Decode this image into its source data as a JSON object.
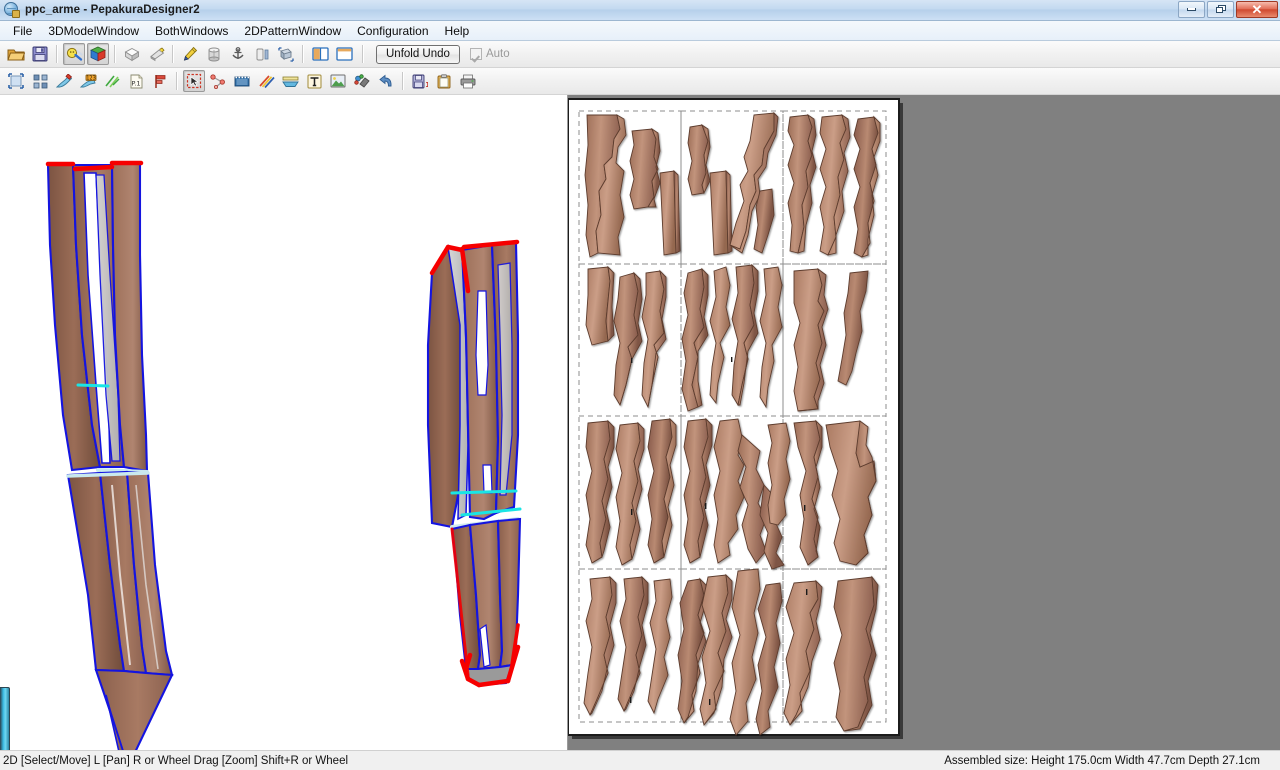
{
  "window": {
    "title": "ppc_arme - PepakuraDesigner2",
    "icon": "app-globe-scissors-icon",
    "buttons": {
      "minimize": "minimize",
      "maximize": "maximize",
      "close": "close"
    }
  },
  "menubar": {
    "items": [
      {
        "label": "File"
      },
      {
        "label": "3DModelWindow"
      },
      {
        "label": "BothWindows"
      },
      {
        "label": "2DPatternWindow"
      },
      {
        "label": "Configuration"
      },
      {
        "label": "Help"
      }
    ]
  },
  "toolbar_primary": {
    "buttons": [
      {
        "icon": "open-folder-icon",
        "pressed": false
      },
      {
        "icon": "save-disk-icon",
        "pressed": false
      },
      {
        "sep": true
      },
      {
        "icon": "unfold-tool-icon",
        "pressed": true
      },
      {
        "icon": "color-cube-icon",
        "pressed": true
      },
      {
        "sep": true
      },
      {
        "icon": "flat-shading-icon",
        "pressed": false
      },
      {
        "icon": "smooth-shading-icon",
        "pressed": false
      },
      {
        "sep": true
      },
      {
        "icon": "pencil-edit-icon",
        "pressed": false
      },
      {
        "icon": "cylinder-icon",
        "pressed": false
      },
      {
        "icon": "anchor-join-icon",
        "pressed": false
      },
      {
        "icon": "split-face-icon",
        "pressed": false
      },
      {
        "icon": "rotate-model-icon",
        "pressed": false
      },
      {
        "sep": true
      },
      {
        "icon": "split-window-icon",
        "pressed": false
      },
      {
        "icon": "single-window-icon",
        "pressed": false
      },
      {
        "sep": true
      }
    ],
    "unfold_undo_label": "Unfold Undo",
    "auto_label": "Auto",
    "auto_checked": true,
    "auto_enabled": false
  },
  "toolbar_secondary": {
    "buttons": [
      {
        "icon": "select-region-icon",
        "pressed": false
      },
      {
        "icon": "arrange-parts-icon",
        "pressed": false
      },
      {
        "icon": "paint-edge-icon",
        "pressed": false
      },
      {
        "icon": "number-labels-icon",
        "pressed": false
      },
      {
        "icon": "flip-edge-icon",
        "pressed": false
      },
      {
        "icon": "page-number-icon",
        "pressed": false
      },
      {
        "icon": "flag-marker-icon",
        "pressed": false
      },
      {
        "sep": true
      },
      {
        "icon": "select-move-cursor-icon",
        "pressed": true
      },
      {
        "icon": "edge-connect-icon",
        "pressed": false
      },
      {
        "icon": "cut-line-icon",
        "pressed": false
      },
      {
        "icon": "fold-line-icon",
        "pressed": false
      },
      {
        "icon": "flap-tab-icon",
        "pressed": false
      },
      {
        "icon": "text-tool-icon",
        "pressed": false
      },
      {
        "icon": "image-tool-icon",
        "pressed": false
      },
      {
        "icon": "texture-paint-icon",
        "pressed": false
      },
      {
        "icon": "undo-arrow-icon",
        "pressed": false
      },
      {
        "sep": true
      },
      {
        "icon": "save-page-icon",
        "pressed": false
      },
      {
        "icon": "clipboard-icon",
        "pressed": false
      },
      {
        "icon": "print-icon",
        "pressed": false
      }
    ]
  },
  "panes": {
    "model_3d": {
      "name": "3D Model Window",
      "background": "#ffffff",
      "edge_colors": {
        "open_edge": "#ff0000",
        "fold_edge": "#0000ff",
        "glued_edge": "#00e5e5"
      },
      "material_color": "#9d6f59"
    },
    "pattern_2d": {
      "name": "2D Pattern Window",
      "background": "#808080",
      "paper_color": "#ffffff",
      "guide_line_color": "#9a9a9a",
      "pages": {
        "columns": 3,
        "rows": 4
      }
    }
  },
  "statusbar": {
    "hint": "2D [Select/Move] L [Pan] R or Wheel Drag [Zoom] Shift+R or Wheel",
    "assembled_size": "Assembled size: Height 175.0cm Width 47.7cm Depth 27.1cm"
  }
}
